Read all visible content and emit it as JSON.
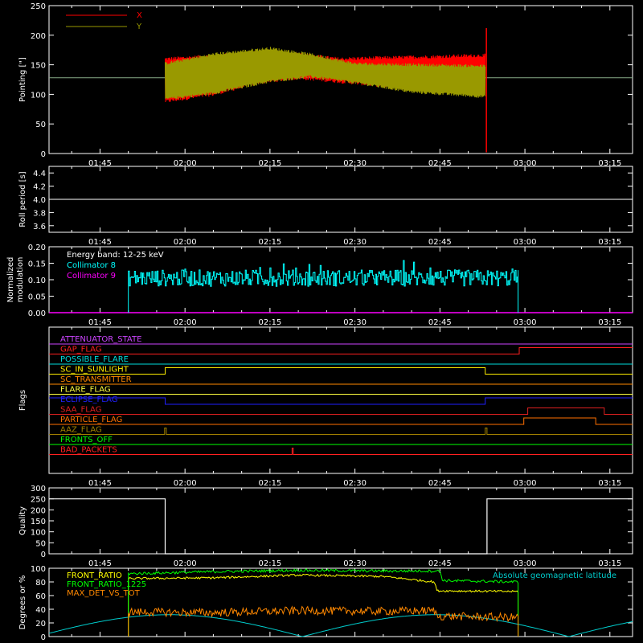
{
  "time_axis": {
    "tick_labels": [
      "01:45",
      "02:00",
      "02:15",
      "02:30",
      "02:45",
      "03:00",
      "03:15"
    ],
    "tick_minutes": [
      105,
      120,
      135,
      150,
      165,
      180,
      195
    ],
    "range_minutes": [
      96,
      199
    ]
  },
  "chart_data": [
    {
      "type": "line",
      "ylabel": "Pointing [\"]",
      "ylim": [
        0,
        250
      ],
      "yticks": [
        0,
        50,
        100,
        150,
        200,
        250
      ],
      "legend_placement": "top-left",
      "series": [
        {
          "name": "X",
          "color": "#ff0000",
          "t_start": 116.5,
          "t_end": 173.0,
          "upper": [
            [
              116.5,
              160
            ],
            [
              125,
              165
            ],
            [
              133,
              172
            ],
            [
              140,
              168
            ],
            [
              147,
              160
            ],
            [
              160,
              163
            ],
            [
              173,
              166
            ]
          ],
          "lower": [
            [
              116.5,
              88
            ],
            [
              125,
              100
            ],
            [
              133,
              120
            ],
            [
              140,
              128
            ],
            [
              147,
              122
            ],
            [
              160,
              110
            ],
            [
              173,
              100
            ]
          ],
          "spike_t": 173.2,
          "spike_range": [
            2,
            212
          ],
          "flat_value": 128
        }
      ],
      "series_y": {
        "name": "Y",
        "color": "#999900",
        "upper": [
          [
            116.5,
            152
          ],
          [
            125,
            168
          ],
          [
            135,
            178
          ],
          [
            142,
            168
          ],
          [
            150,
            152
          ],
          [
            160,
            150
          ],
          [
            173,
            148
          ]
        ],
        "lower": [
          [
            116.5,
            92
          ],
          [
            125,
            102
          ],
          [
            135,
            122
          ],
          [
            142,
            130
          ],
          [
            150,
            120
          ],
          [
            160,
            104
          ],
          [
            173,
            96
          ]
        ]
      }
    },
    {
      "type": "line",
      "ylabel": "Roll period [s]",
      "ylim": [
        3.5,
        4.5
      ],
      "yticks": [
        3.6,
        3.8,
        4.0,
        4.2,
        4.4
      ],
      "series": [
        {
          "name": "",
          "color": "#ffffff",
          "constant": 4.0
        }
      ]
    },
    {
      "type": "line",
      "ylabel": "Normalized modulation",
      "ylim": [
        0,
        0.2
      ],
      "yticks": [
        0.0,
        0.05,
        0.1,
        0.15,
        0.2
      ],
      "annotation": "Energy band: 12-25 keV",
      "legend_placement": "top-left",
      "series": [
        {
          "name": "Collimator 8",
          "color": "#00ffff",
          "t_start": 110.0,
          "t_end": 178.8,
          "mean": 0.105,
          "noise": 0.025
        },
        {
          "name": "Collimator 9",
          "color": "#ff00ff",
          "constant": 0.0
        }
      ]
    },
    {
      "type": "line",
      "ylabel": "Flags",
      "flags": [
        {
          "name": "ATTENUATOR_STATE",
          "color": "#cc44ff",
          "steps": [
            [
              96,
              0
            ],
            [
              199,
              0
            ]
          ]
        },
        {
          "name": "GAP_FLAG",
          "color": "#ff2020",
          "steps": [
            [
              96,
              0
            ],
            [
              179,
              1
            ],
            [
              199,
              1
            ]
          ]
        },
        {
          "name": "POSSIBLE_FLARE",
          "color": "#00dddd",
          "steps": [
            [
              96,
              0
            ],
            [
              199,
              0
            ]
          ]
        },
        {
          "name": "SC_IN_SUNLIGHT",
          "color": "#ffee00",
          "steps": [
            [
              96,
              0
            ],
            [
              116.5,
              1
            ],
            [
              173,
              0
            ],
            [
              199,
              0
            ]
          ]
        },
        {
          "name": "SC_TRANSMITTER",
          "color": "#ff8800",
          "steps": [
            [
              96,
              0
            ],
            [
              199,
              0
            ]
          ]
        },
        {
          "name": "FLARE_FLAG",
          "color": "#ffff40",
          "steps": [
            [
              96,
              0
            ],
            [
              199,
              0
            ]
          ]
        },
        {
          "name": "ECLIPSE_FLAG",
          "color": "#2020ff",
          "steps": [
            [
              96,
              1
            ],
            [
              116.5,
              0
            ],
            [
              173,
              1
            ],
            [
              199,
              1
            ]
          ]
        },
        {
          "name": "SAA_FLAG",
          "color": "#dd2020",
          "steps": [
            [
              96,
              0
            ],
            [
              180.5,
              1
            ],
            [
              194,
              0
            ],
            [
              199,
              0
            ]
          ]
        },
        {
          "name": "PARTICLE_FLAG",
          "color": "#ff7000",
          "steps": [
            [
              96,
              0
            ],
            [
              179.8,
              1
            ],
            [
              192.5,
              0
            ],
            [
              199,
              0
            ]
          ]
        },
        {
          "name": "AAZ_FLAG",
          "color": "#a08000",
          "steps": [
            [
              96,
              0
            ],
            [
              116.4,
              1
            ],
            [
              116.7,
              0
            ],
            [
              173,
              1
            ],
            [
              173.3,
              0
            ],
            [
              199,
              0
            ]
          ]
        },
        {
          "name": "FRONTS_OFF",
          "color": "#00ff00",
          "steps": [
            [
              96,
              0
            ],
            [
              199,
              0
            ]
          ]
        },
        {
          "name": "BAD_PACKETS",
          "color": "#ff2020",
          "steps": [
            [
              96,
              0
            ],
            [
              138.9,
              1
            ],
            [
              139.1,
              0
            ],
            [
              199,
              0
            ]
          ]
        }
      ]
    },
    {
      "type": "line",
      "ylabel": "Quality",
      "ylim": [
        0,
        300
      ],
      "yticks": [
        0,
        50,
        100,
        150,
        200,
        250,
        300
      ],
      "series": [
        {
          "name": "",
          "color": "#ffffff",
          "steps": [
            [
              96,
              250
            ],
            [
              116.5,
              250
            ],
            [
              116.5,
              0
            ],
            [
              173.3,
              0
            ],
            [
              173.3,
              250
            ],
            [
              199,
              250
            ]
          ]
        }
      ]
    },
    {
      "type": "line",
      "ylabel": "Degrees or %",
      "ylim": [
        0,
        100
      ],
      "yticks": [
        0,
        20,
        40,
        60,
        80,
        100
      ],
      "legend_placement": "top-left",
      "right_label": "Absolute geomagnetic latitude",
      "series": [
        {
          "name": "FRONT_RATIO",
          "color": "#ffff00",
          "t_start": 110.0,
          "t_end": 178.8,
          "profile": [
            [
              110,
              85
            ],
            [
              125,
              86
            ],
            [
              140,
              90
            ],
            [
              155,
              88
            ],
            [
              164,
              80
            ],
            [
              164.5,
              67
            ],
            [
              178.8,
              66
            ]
          ]
        },
        {
          "name": "FRONT_RATIO_1225",
          "color": "#00ff00",
          "t_start": 110.0,
          "t_end": 178.8,
          "profile": [
            [
              110,
              92
            ],
            [
              125,
              95
            ],
            [
              140,
              97
            ],
            [
              155,
              96
            ],
            [
              165,
              96
            ],
            [
              165.5,
              82
            ],
            [
              178.8,
              80
            ]
          ]
        },
        {
          "name": "MAX_DET_VS_TOT",
          "color": "#ff8800",
          "t_start": 110.0,
          "t_end": 178.8,
          "profile": [
            [
              110,
              36
            ],
            [
              125,
              35
            ],
            [
              140,
              38
            ],
            [
              155,
              37
            ],
            [
              164,
              38
            ],
            [
              164.5,
              30
            ],
            [
              178.8,
              28
            ]
          ]
        },
        {
          "name": "Absolute geomagnetic latitude",
          "color": "#00cccc"
        }
      ]
    }
  ]
}
